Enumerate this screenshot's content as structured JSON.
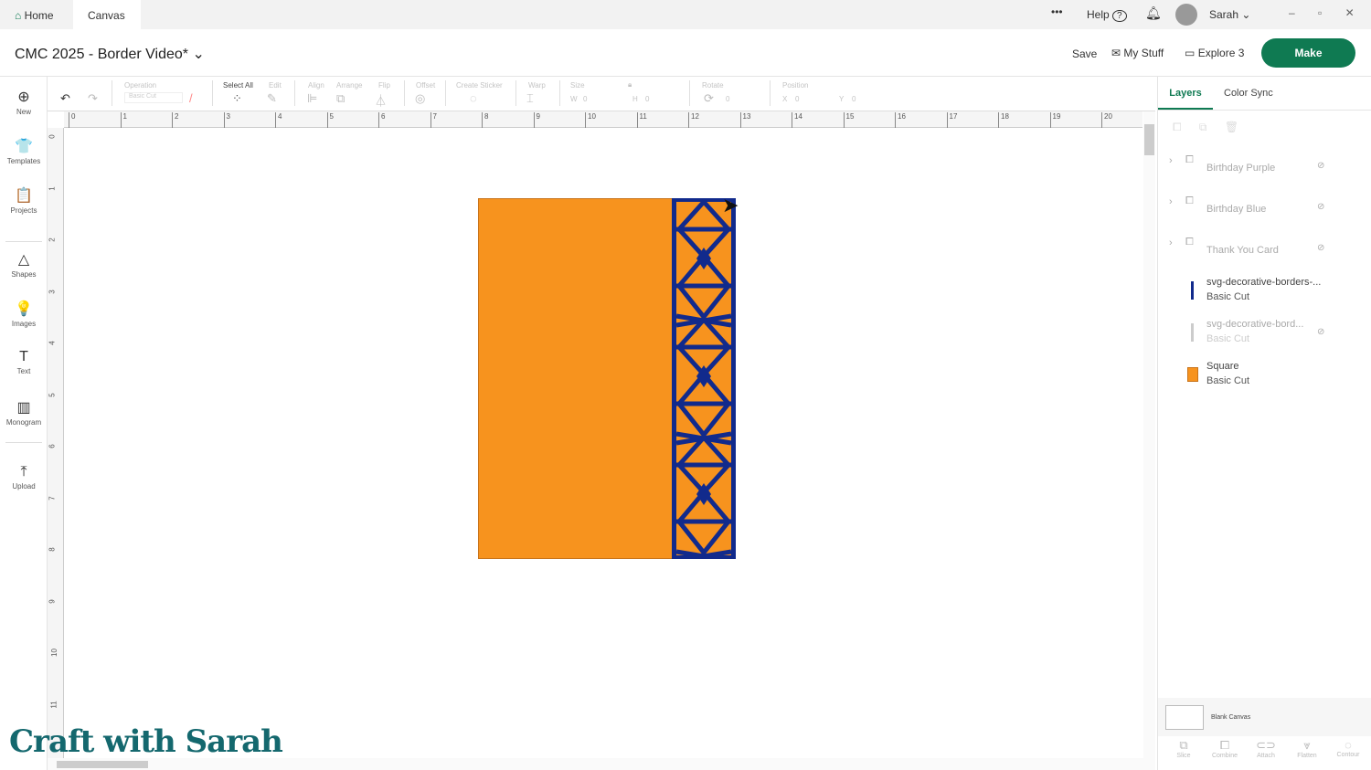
{
  "tabs": {
    "home": "Home",
    "canvas": "Canvas"
  },
  "topbar": {
    "more": "•••",
    "help": "Help",
    "user": "Sarah"
  },
  "title": {
    "project": "CMC 2025 - Border Video*",
    "save": "Save",
    "my_stuff": "My Stuff",
    "machine": "Explore 3",
    "make": "Make"
  },
  "toolbar": {
    "operation": "Operation",
    "operation_value": "Basic Cut",
    "select_all": "Select All",
    "edit": "Edit",
    "align": "Align",
    "arrange": "Arrange",
    "flip": "Flip",
    "offset": "Offset",
    "create_sticker": "Create Sticker",
    "warp": "Warp",
    "size": "Size",
    "w": "W",
    "h": "H",
    "rotate": "Rotate",
    "position": "Position",
    "x": "X",
    "y": "Y",
    "zero": "0"
  },
  "leftbar": [
    {
      "label": "New",
      "icon": "⊕"
    },
    {
      "label": "Templates",
      "icon": "👕"
    },
    {
      "label": "Projects",
      "icon": "📋"
    },
    {
      "label": "Shapes",
      "icon": "△"
    },
    {
      "label": "Images",
      "icon": "💡"
    },
    {
      "label": "Text",
      "icon": "T"
    },
    {
      "label": "Monogram",
      "icon": "▥"
    },
    {
      "label": "Upload",
      "icon": "⤒"
    }
  ],
  "ruler": {
    "h": [
      "0",
      "1",
      "2",
      "3",
      "4",
      "5",
      "6",
      "7",
      "8",
      "9",
      "10",
      "11",
      "12",
      "13",
      "14",
      "15",
      "16",
      "17",
      "18",
      "19",
      "20"
    ],
    "v": [
      "0",
      "1",
      "2",
      "3",
      "4",
      "5",
      "6",
      "7",
      "8",
      "9",
      "10",
      "11"
    ]
  },
  "panel": {
    "tabs": {
      "layers": "Layers",
      "color_sync": "Color Sync"
    },
    "layers": [
      {
        "name": "Birthday Purple",
        "sub": "",
        "type": "group",
        "hidden": true
      },
      {
        "name": "Birthday Blue",
        "sub": "",
        "type": "group",
        "hidden": true
      },
      {
        "name": "Thank You Card",
        "sub": "",
        "type": "group",
        "hidden": true
      },
      {
        "name": "svg-decorative-borders-...",
        "sub": "Basic Cut",
        "type": "border",
        "hidden": false
      },
      {
        "name": "svg-decorative-bord...",
        "sub": "Basic Cut",
        "type": "border-faded",
        "hidden": true
      },
      {
        "name": "Square",
        "sub": "Basic Cut",
        "type": "square",
        "hidden": false
      }
    ],
    "blank_canvas": "Blank Canvas",
    "actions": [
      "Slice",
      "Combine",
      "Attach",
      "Flatten",
      "Contour"
    ]
  },
  "watermark": "Craft with Sarah",
  "colors": {
    "accent": "#0f7a52",
    "orange": "#f7931e",
    "navy": "#112a8c"
  }
}
